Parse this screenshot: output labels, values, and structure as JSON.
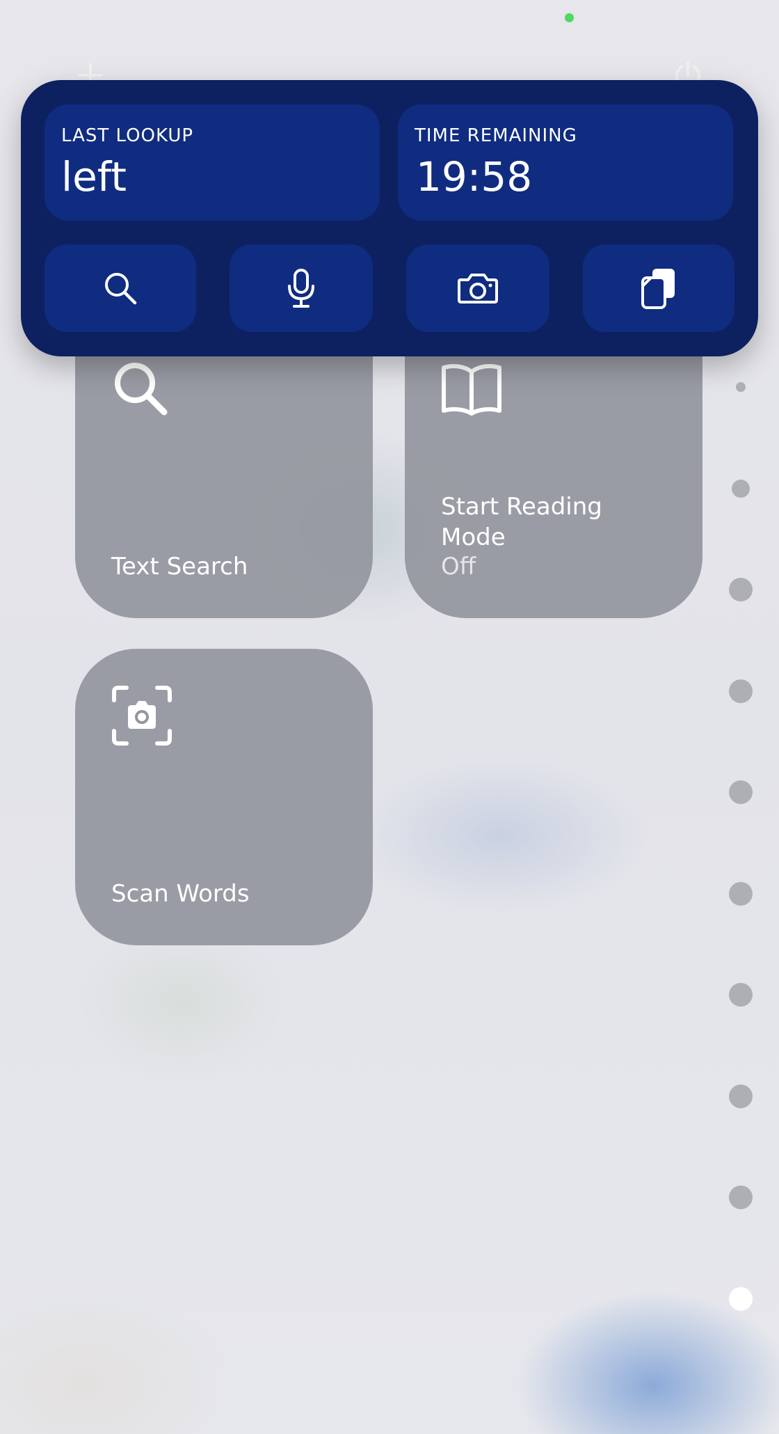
{
  "widget": {
    "last_lookup_label": "LAST LOOKUP",
    "last_lookup_value": "left",
    "time_remaining_label": "TIME REMAINING",
    "time_remaining_value": "19:58",
    "buttons": [
      {
        "icon": "search-icon"
      },
      {
        "icon": "microphone-icon"
      },
      {
        "icon": "camera-icon"
      },
      {
        "icon": "clipboard-icon"
      }
    ],
    "colors": {
      "background": "#0d2160",
      "panel": "#102c80"
    }
  },
  "controls": [
    {
      "label": "Text Search",
      "icon": "search-icon"
    },
    {
      "label": "Start Reading Mode",
      "status": "Off",
      "icon": "book-icon"
    },
    {
      "label": "Scan Words",
      "icon": "camera-scan-icon"
    }
  ],
  "page_dots": {
    "count": 10,
    "active_index": 9
  },
  "status": {
    "camera_indicator_color": "#4cd964"
  }
}
